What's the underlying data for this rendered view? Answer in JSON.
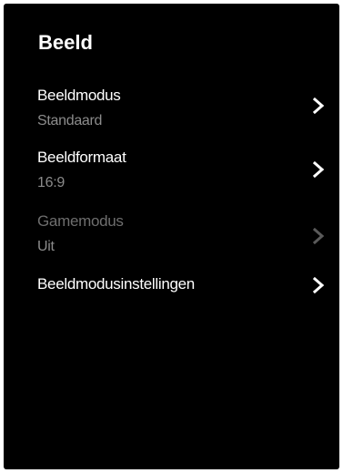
{
  "header": {
    "title": "Beeld"
  },
  "menu": {
    "items": [
      {
        "label": "Beeldmodus",
        "value": "Standaard",
        "enabled": true,
        "icon": "chevron-right-icon"
      },
      {
        "label": "Beeldformaat",
        "value": "16:9",
        "enabled": true,
        "icon": "chevron-right-icon"
      },
      {
        "label": "Gamemodus",
        "value": "Uit",
        "enabled": false,
        "icon": "chevron-right-icon"
      },
      {
        "label": "Beeldmodusinstellingen",
        "value": "",
        "enabled": true,
        "icon": "chevron-right-icon"
      }
    ]
  },
  "colors": {
    "background": "#000000",
    "text_primary": "#ffffff",
    "text_secondary": "#8c8c8c",
    "text_disabled": "#6e6e6e",
    "chevron_enabled": "#ffffff",
    "chevron_disabled": "#5a5a5a"
  }
}
